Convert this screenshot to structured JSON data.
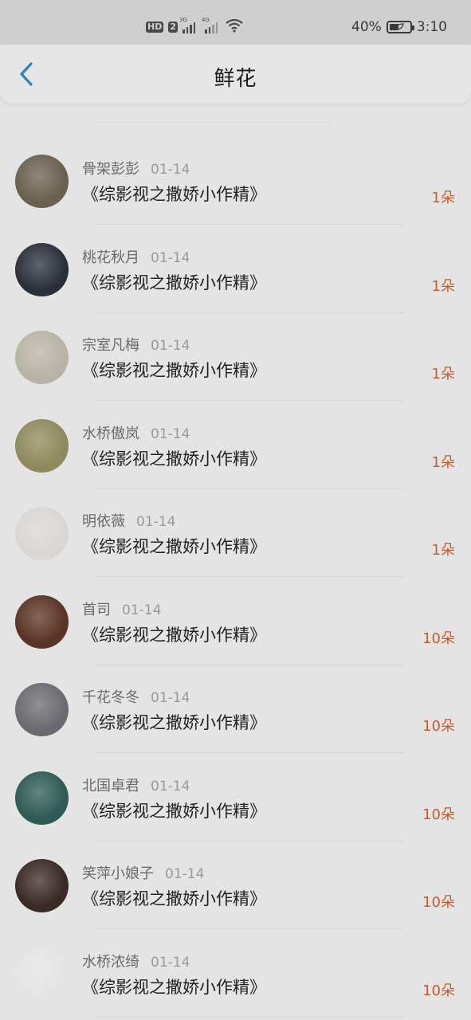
{
  "status_bar": {
    "hd": "HD",
    "sim_slot": "2",
    "net1": "3G",
    "net2": "4G",
    "battery_percent": "40%",
    "time": "3:10",
    "battery_level": 0.4
  },
  "nav": {
    "title": "鲜花"
  },
  "rows": [
    {
      "name": "骨架彭彭",
      "date": "01-14",
      "book": "《综影视之撒娇小作精》",
      "count": "1朵",
      "avatar_color": "#6b6050"
    },
    {
      "name": "桃花秋月",
      "date": "01-14",
      "book": "《综影视之撒娇小作精》",
      "count": "1朵",
      "avatar_color": "#2a2f3a"
    },
    {
      "name": "宗室凡梅",
      "date": "01-14",
      "book": "《综影视之撒娇小作精》",
      "count": "1朵",
      "avatar_color": "#b9b3a6"
    },
    {
      "name": "水桥傲岚",
      "date": "01-14",
      "book": "《综影视之撒娇小作精》",
      "count": "1朵",
      "avatar_color": "#8e8a5c"
    },
    {
      "name": "明依薇",
      "date": "01-14",
      "book": "《综影视之撒娇小作精》",
      "count": "1朵",
      "avatar_color": "#d9d6d3"
    },
    {
      "name": "首司",
      "date": "01-14",
      "book": "《综影视之撒娇小作精》",
      "count": "10朵",
      "avatar_color": "#5a3424"
    },
    {
      "name": "千花冬冬",
      "date": "01-14",
      "book": "《综影视之撒娇小作精》",
      "count": "10朵",
      "avatar_color": "#6a6a70"
    },
    {
      "name": "北国卓君",
      "date": "01-14",
      "book": "《综影视之撒娇小作精》",
      "count": "10朵",
      "avatar_color": "#2f5a55"
    },
    {
      "name": "笑萍小娘子",
      "date": "01-14",
      "book": "《综影视之撒娇小作精》",
      "count": "10朵",
      "avatar_color": "#3a2a26"
    },
    {
      "name": "水桥浓绮",
      "date": "01-14",
      "book": "《综影视之撒娇小作精》",
      "count": "10朵",
      "avatar_color": "#e4e4e4"
    }
  ]
}
